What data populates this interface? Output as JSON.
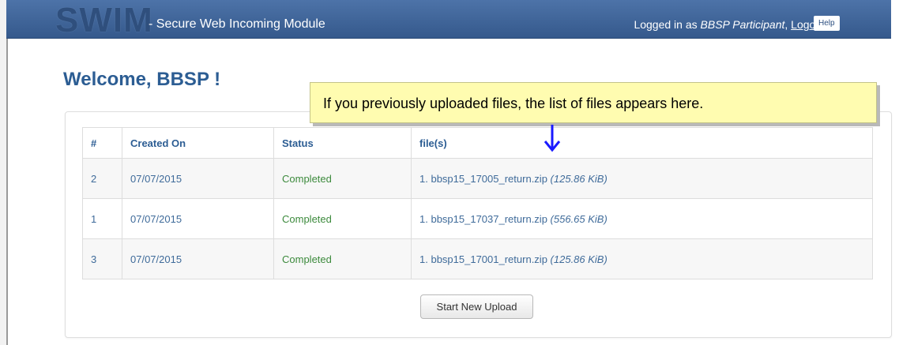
{
  "navbar": {
    "logo": "SWIM",
    "subtitle": "- Secure Web Incoming Module",
    "logged_in_prefix": "Logged in as ",
    "user": "BBSP Participant",
    "separator": ", ",
    "logout": "Logout",
    "help": "Help",
    "color": "#3b6196"
  },
  "page": {
    "welcome": "Welcome, BBSP !"
  },
  "callout": {
    "text": "If you previously uploaded files, the list of files appears here."
  },
  "table": {
    "headers": [
      "#",
      "Created On",
      "Status",
      "file(s)"
    ],
    "rows": [
      {
        "num": "2",
        "created": "07/07/2015",
        "status": "Completed",
        "file_index": "1.",
        "file_name": "bbsp15_17005_return.zip",
        "file_size": "(125.86 KiB)"
      },
      {
        "num": "1",
        "created": "07/07/2015",
        "status": "Completed",
        "file_index": "1.",
        "file_name": "bbsp15_17037_return.zip",
        "file_size": "(556.65 KiB)"
      },
      {
        "num": "3",
        "created": "07/07/2015",
        "status": "Completed",
        "file_index": "1.",
        "file_name": "bbsp15_17001_return.zip",
        "file_size": "(125.86 KiB)"
      }
    ]
  },
  "actions": {
    "start_upload": "Start New Upload"
  }
}
